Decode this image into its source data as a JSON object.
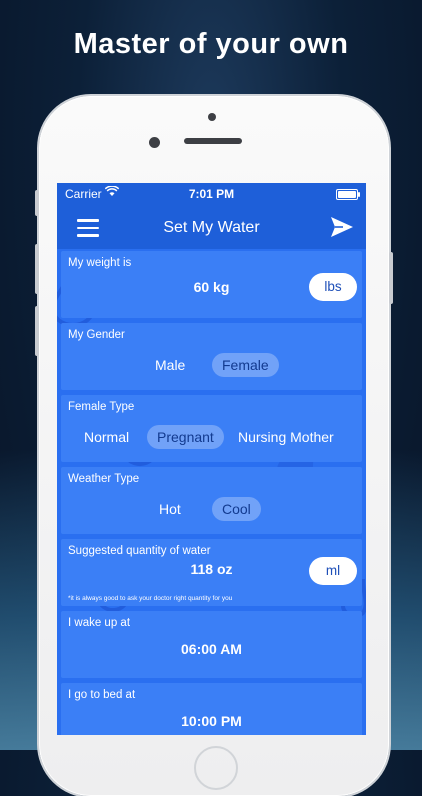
{
  "headline": "Master of your own",
  "status": {
    "carrier": "Carrier",
    "time": "7:01 PM"
  },
  "nav": {
    "title": "Set My Water"
  },
  "weight": {
    "label": "My weight is",
    "value": "60 kg",
    "unit_button": "lbs"
  },
  "gender": {
    "label": "My Gender",
    "options": [
      "Male",
      "Female"
    ],
    "selected": "Female"
  },
  "female_type": {
    "label": "Female Type",
    "options": [
      "Normal",
      "Pregnant",
      "Nursing Mother"
    ],
    "selected": "Pregnant"
  },
  "weather": {
    "label": "Weather Type",
    "options": [
      "Hot",
      "Cool"
    ],
    "selected": "Cool"
  },
  "suggested": {
    "label": "Suggested quantity of water",
    "value": "118 oz",
    "unit_button": "ml",
    "note": "*it is always good to ask your doctor right quantity for you"
  },
  "wake": {
    "label": "I wake up at",
    "value": "06:00 AM"
  },
  "bed": {
    "label": "I go to bed at",
    "value": "10:00 PM"
  },
  "colors": {
    "accent": "#1e5fd9",
    "card": "#3b7ff6",
    "pill_text": "#1e4fb8"
  }
}
